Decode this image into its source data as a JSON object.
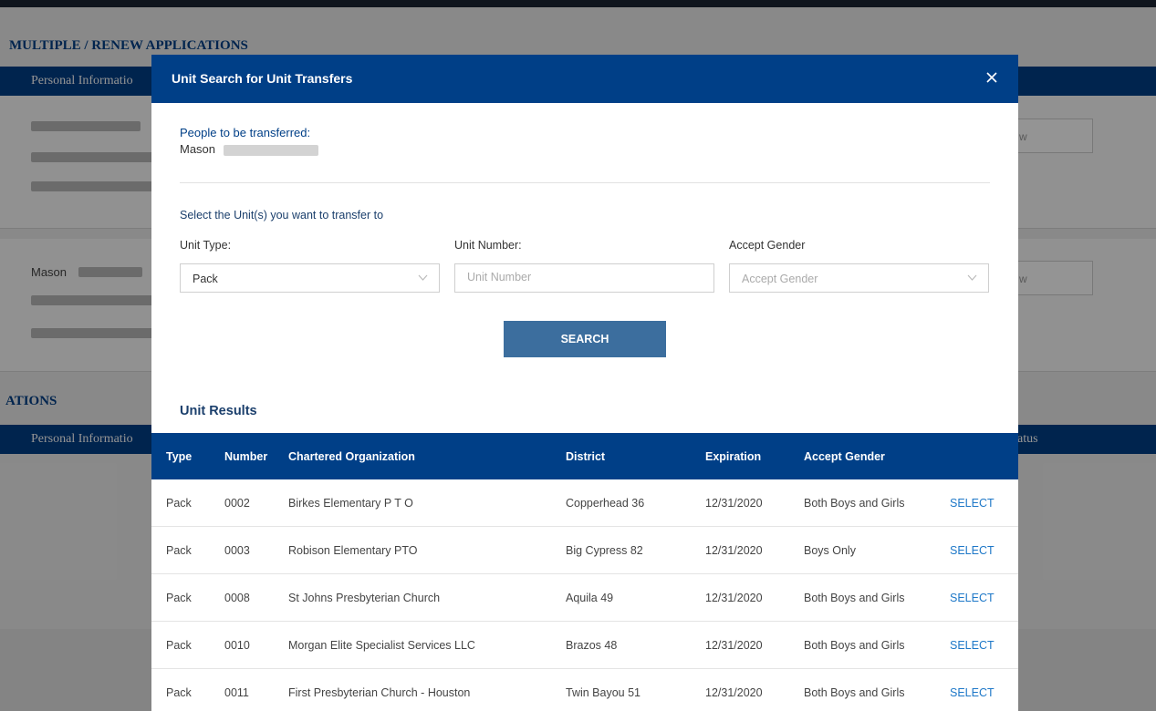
{
  "background": {
    "section1_title": "MULTIPLE / RENEW APPLICATIONS",
    "header1_label": "Personal Informatio",
    "card2_name": "Mason",
    "section2_title": "ATIONS",
    "header2_label": "Personal Informatio",
    "header2_right": "atus",
    "btn_fragment": "w"
  },
  "modal": {
    "title": "Unit Search for Unit Transfers",
    "close_label": "×",
    "people_label": "People to be transferred:",
    "people_name": "Mason",
    "select_prompt": "Select the Unit(s) you want to transfer to",
    "unit_type_label": "Unit Type:",
    "unit_type_value": "Pack",
    "unit_number_label": "Unit Number:",
    "unit_number_placeholder": "Unit Number",
    "accept_gender_label": "Accept Gender",
    "accept_gender_placeholder": "Accept Gender",
    "search_label": "SEARCH",
    "results_title": "Unit Results",
    "columns": [
      "Type",
      "Number",
      "Chartered Organization",
      "District",
      "Expiration",
      "Accept Gender",
      ""
    ],
    "rows": [
      {
        "type": "Pack",
        "number": "0002",
        "org": "Birkes Elementary P T O",
        "district": "Copperhead 36",
        "expiration": "12/31/2020",
        "gender": "Both Boys and Girls",
        "action": "SELECT"
      },
      {
        "type": "Pack",
        "number": "0003",
        "org": "Robison Elementary PTO",
        "district": "Big Cypress 82",
        "expiration": "12/31/2020",
        "gender": "Boys Only",
        "action": "SELECT"
      },
      {
        "type": "Pack",
        "number": "0008",
        "org": "St Johns Presbyterian Church",
        "district": "Aquila 49",
        "expiration": "12/31/2020",
        "gender": "Both Boys and Girls",
        "action": "SELECT"
      },
      {
        "type": "Pack",
        "number": "0010",
        "org": "Morgan Elite Specialist Services LLC",
        "district": "Brazos 48",
        "expiration": "12/31/2020",
        "gender": "Both Boys and Girls",
        "action": "SELECT"
      },
      {
        "type": "Pack",
        "number": "0011",
        "org": "First Presbyterian Church - Houston",
        "district": "Twin Bayou 51",
        "expiration": "12/31/2020",
        "gender": "Both Boys and Girls",
        "action": "SELECT"
      }
    ]
  },
  "colors": {
    "primary": "#003f87",
    "button": "#3c6e9e",
    "link": "#1e78c8"
  }
}
